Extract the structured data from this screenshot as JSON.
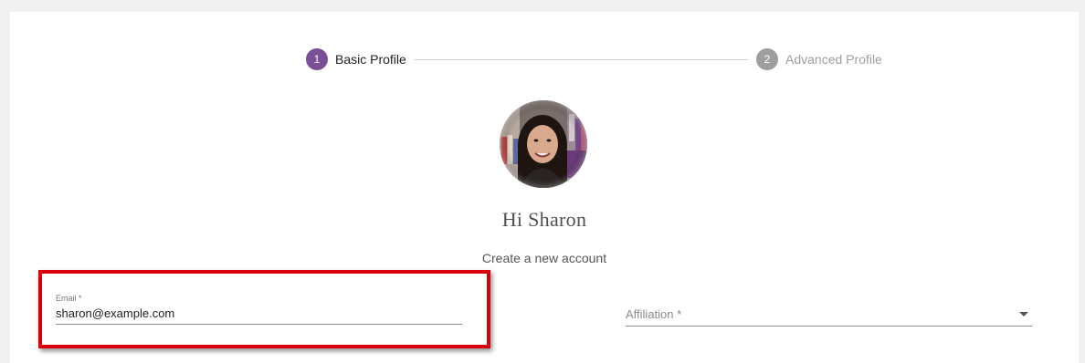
{
  "stepper": {
    "steps": [
      {
        "number": "1",
        "label": "Basic Profile",
        "active": true
      },
      {
        "number": "2",
        "label": "Advanced Profile",
        "active": false
      }
    ]
  },
  "profile": {
    "greeting": "Hi Sharon",
    "subtitle": "Create a new account"
  },
  "form": {
    "email": {
      "label": "Email *",
      "value": "sharon@example.com"
    },
    "affiliation": {
      "placeholder": "Affiliation *"
    }
  },
  "colors": {
    "accent": "#7b4f96",
    "inactive_step": "#9e9e9e",
    "highlight": "#d9000d"
  }
}
